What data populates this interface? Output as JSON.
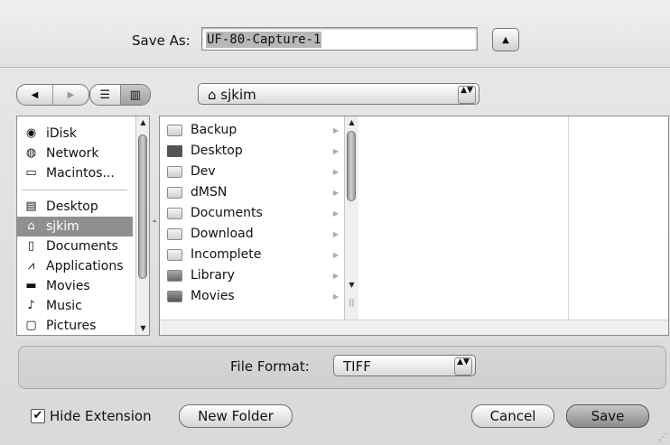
{
  "save_as": {
    "label": "Save As:",
    "filename": "UF-80-Capture-1",
    "collapse_symbol": "▲"
  },
  "toolbar": {
    "back_symbol": "◀",
    "forward_symbol": "▶",
    "list_view_symbol": "☰",
    "column_view_symbol": "▥",
    "location": "sjkim",
    "popup_arrows": "▲▼"
  },
  "sidebar": {
    "items": [
      {
        "label": "iDisk",
        "icon": "idisk-icon",
        "glyph": "◉",
        "selected": false
      },
      {
        "label": "Network",
        "icon": "network-icon",
        "glyph": "◍",
        "selected": false
      },
      {
        "label": "Macintos...",
        "icon": "hard-disk-icon",
        "glyph": "▭",
        "selected": false
      },
      {
        "label": "Desktop",
        "icon": "desktop-icon",
        "glyph": "▤",
        "selected": false
      },
      {
        "label": "sjkim",
        "icon": "home-icon",
        "glyph": "⌂",
        "selected": true
      },
      {
        "label": "Documents",
        "icon": "documents-icon",
        "glyph": "▯",
        "selected": false
      },
      {
        "label": "Applications",
        "icon": "applications-icon",
        "glyph": "⩘",
        "selected": false
      },
      {
        "label": "Movies",
        "icon": "movies-icon",
        "glyph": "▬",
        "selected": false
      },
      {
        "label": "Music",
        "icon": "music-icon",
        "glyph": "♪",
        "selected": false
      },
      {
        "label": "Pictures",
        "icon": "pictures-icon",
        "glyph": "▢",
        "selected": false
      }
    ]
  },
  "browser": {
    "column1": [
      {
        "label": "Backup",
        "icon": "folder-icon"
      },
      {
        "label": "Desktop",
        "icon": "desktop-folder-icon"
      },
      {
        "label": "Dev",
        "icon": "folder-icon"
      },
      {
        "label": "dMSN",
        "icon": "folder-icon"
      },
      {
        "label": "Documents",
        "icon": "documents-folder-icon"
      },
      {
        "label": "Download",
        "icon": "folder-icon"
      },
      {
        "label": "Incomplete",
        "icon": "folder-icon"
      },
      {
        "label": "Library",
        "icon": "library-folder-icon"
      },
      {
        "label": "Movies",
        "icon": "movies-folder-icon"
      }
    ],
    "disclosure_symbol": "▶"
  },
  "format": {
    "label": "File Format:",
    "value": "TIFF"
  },
  "footer": {
    "hide_extension_label": "Hide Extension",
    "hide_extension_checked": true,
    "check_symbol": "✔",
    "new_folder_label": "New Folder",
    "cancel_label": "Cancel",
    "save_label": "Save"
  }
}
